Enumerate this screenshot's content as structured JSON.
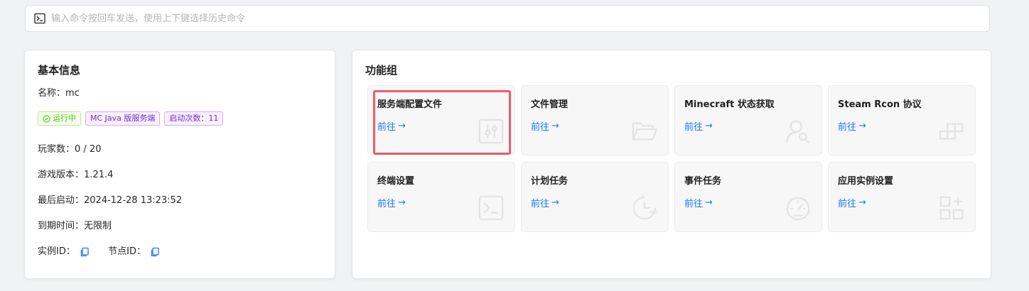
{
  "command": {
    "placeholder": "输入命令按回车发送，使用上下键选择历史命令"
  },
  "info": {
    "title": "基本信息",
    "name_label": "名称：",
    "name_value": "mc",
    "tags": {
      "status": "运行中",
      "type": "MC Java 版服务端",
      "starts": "启动次数：11"
    },
    "players_label": "玩家数：",
    "players_value": "0 / 20",
    "version_label": "游戏版本：",
    "version_value": "1.21.4",
    "last_start_label": "最后启动：",
    "last_start_value": "2024-12-28 13:23:52",
    "expire_label": "到期时间：",
    "expire_value": "无限制",
    "instance_id_label": "实例ID：",
    "node_id_label": "节点ID："
  },
  "func": {
    "title": "功能组",
    "goto_label": "前往",
    "tiles": [
      {
        "title": "服务端配置文件",
        "icon": "sliders-icon"
      },
      {
        "title": "文件管理",
        "icon": "folder-open-icon"
      },
      {
        "title": "Minecraft 状态获取",
        "icon": "user-search-icon"
      },
      {
        "title": "Steam Rcon 协议",
        "icon": "blocks-icon"
      },
      {
        "title": "终端设置",
        "icon": "terminal-icon"
      },
      {
        "title": "计划任务",
        "icon": "clock-icon"
      },
      {
        "title": "事件任务",
        "icon": "dashboard-icon"
      },
      {
        "title": "应用实例设置",
        "icon": "appstore-add-icon"
      }
    ]
  },
  "colors": {
    "accent": "#1677ff",
    "highlight": "#ef5a6b",
    "running": "#52c41a",
    "tag_purple": "#722ed1"
  }
}
